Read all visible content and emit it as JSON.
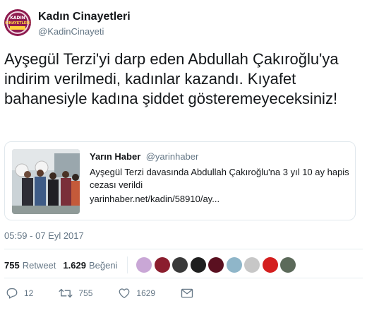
{
  "account": {
    "display_name": "Kadın Cinayetleri",
    "handle": "@KadinCinayeti",
    "avatar_text_top": "KADIN",
    "avatar_text_mid": "CİNAYETLERİ"
  },
  "tweet": {
    "text": "Ayşegül Terzi'yi darp eden Abdullah Çakıroğlu'ya indirim verilmedi, kadınlar kazandı. Kıyafet bahanesiyle kadına şiddet gösteremeyeceksiniz!",
    "timestamp": "05:59 - 07 Eyl 2017"
  },
  "quote": {
    "name": "Yarın Haber",
    "handle": "@yarinhaber",
    "text": "Ayşegül Terzi davasında Abdullah Çakıroğlu'na 3 yıl 10 ay hapis cezası verildi",
    "link": "yarinhaber.net/kadin/58910/ay..."
  },
  "stats": {
    "retweet_count": "755",
    "retweet_label": "Retweet",
    "like_count": "1.629",
    "like_label": "Beğeni"
  },
  "likers": [
    {
      "name": "liker-1",
      "color": "#c9a7d6"
    },
    {
      "name": "liker-2",
      "color": "#8b1e2e"
    },
    {
      "name": "liker-3",
      "color": "#3a3a3a"
    },
    {
      "name": "liker-4",
      "color": "#1f1f1f"
    },
    {
      "name": "liker-5",
      "color": "#5a1020"
    },
    {
      "name": "liker-6",
      "color": "#8fb6c9"
    },
    {
      "name": "liker-7",
      "color": "#c7c7c7"
    },
    {
      "name": "liker-8",
      "color": "#d41f1f"
    },
    {
      "name": "liker-9",
      "color": "#5c6a5a"
    }
  ],
  "actions": {
    "reply_count": "12",
    "retweet_count": "755",
    "like_count": "1629"
  },
  "icons": {
    "reply": "reply-icon",
    "retweet": "retweet-icon",
    "like": "heart-icon",
    "dm": "envelope-icon"
  }
}
